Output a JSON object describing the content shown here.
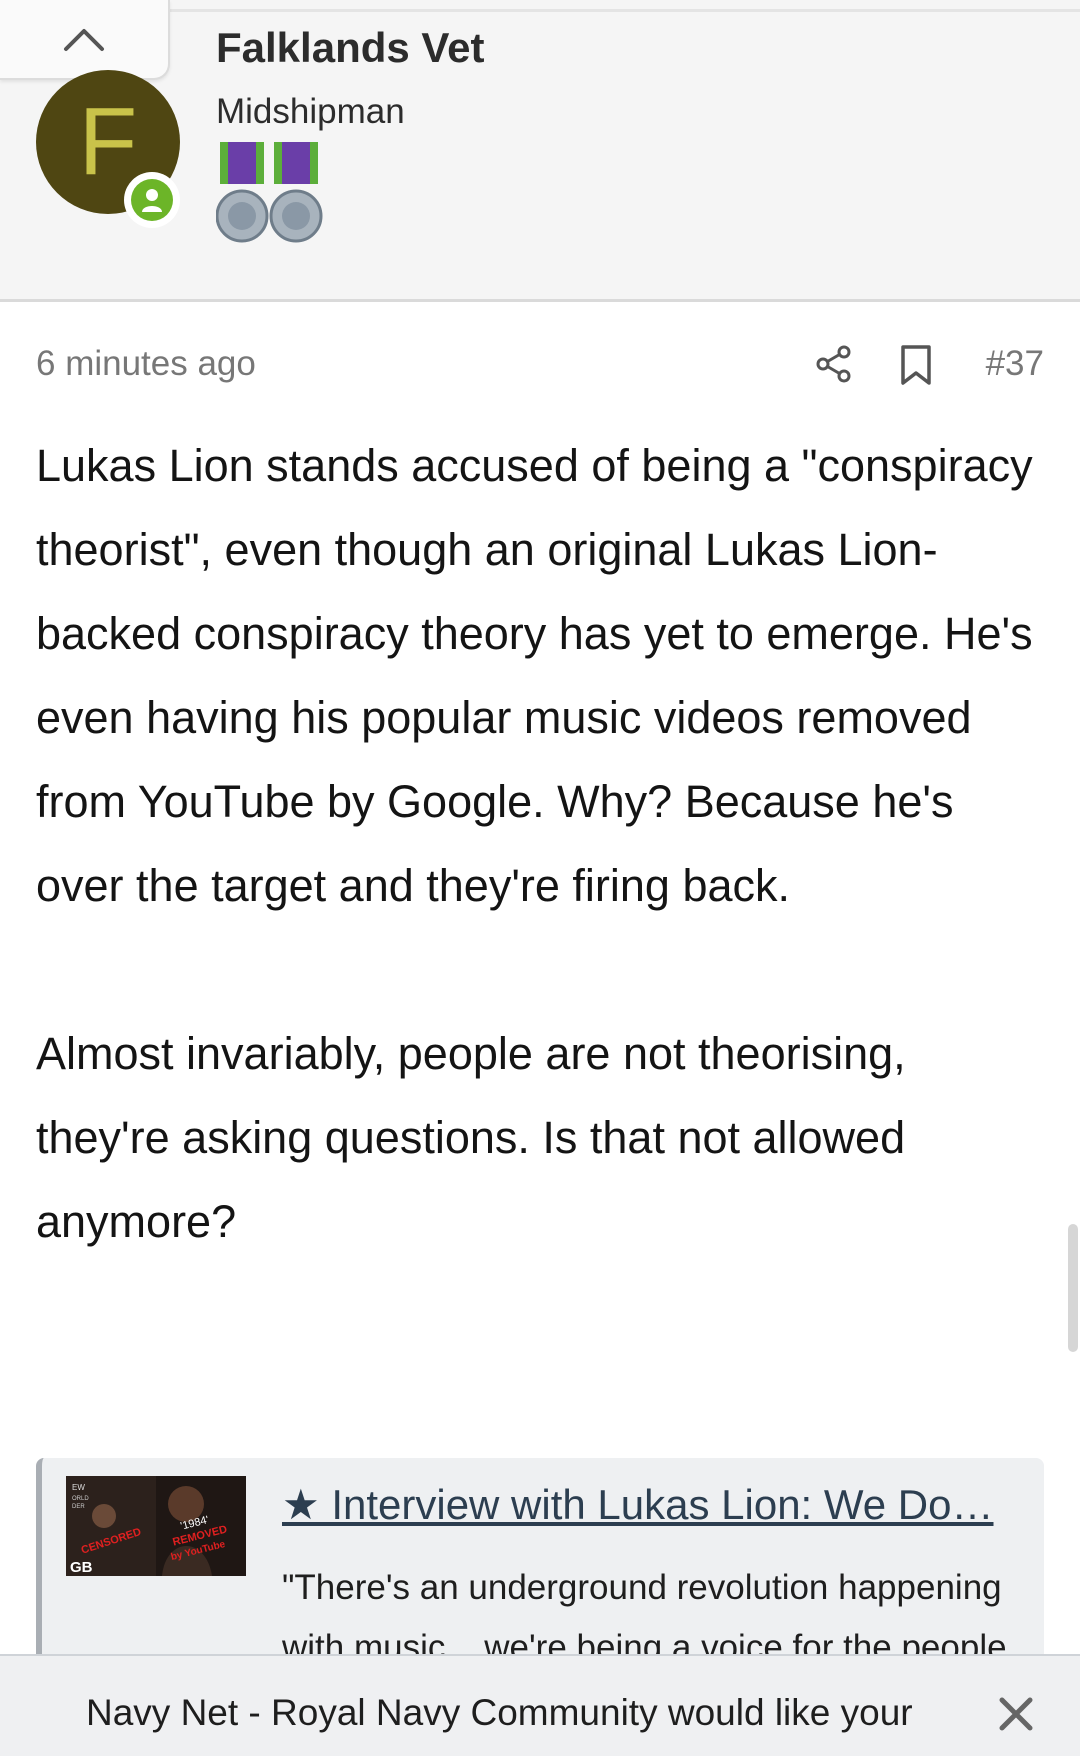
{
  "header": {
    "username": "Falklands Vet",
    "rank": "Midshipman",
    "avatar_letter": "F",
    "avatar_color": "#4f4612",
    "online_color": "#6cb528"
  },
  "post": {
    "time": "6 minutes ago",
    "number": "#37",
    "paragraphs": [
      "Lukas Lion stands accused of being a \"conspiracy theorist\", even though an original Lukas Lion-backed conspiracy theory has yet to emerge. He's even having his popular music videos removed from YouTube by Google. Why? Because he's over the target and they're firing back.",
      "Almost invariably, people are not theorising, they're asking questions. Is that not allowed anymore?"
    ]
  },
  "link_card": {
    "title": "★ Interview with Lukas Lion: We Do…",
    "description": "\"There's an underground revolution happening with music... we're being a voice for the people",
    "thumbnail": {
      "censored": "CENSORED",
      "year": "'1984'",
      "removed": "REMOVED",
      "by": "by YouTube",
      "channel": "GB"
    }
  },
  "consent": {
    "text": "Navy Net - Royal Navy Community would like your"
  }
}
